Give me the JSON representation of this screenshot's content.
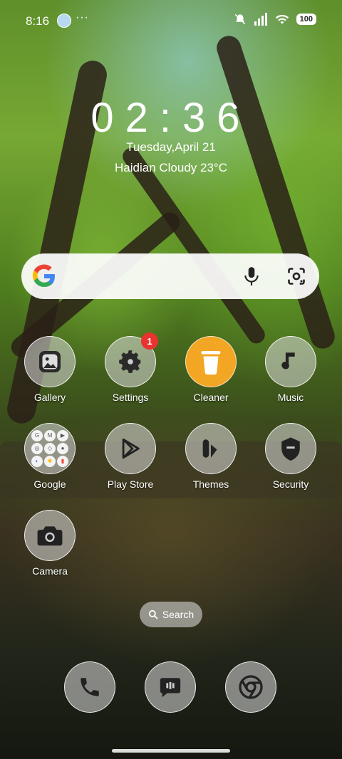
{
  "status_bar": {
    "time": "8:16",
    "dots": "···",
    "battery": "100",
    "icons": [
      "weather-icon",
      "mute-icon",
      "signal-icon",
      "wifi-icon",
      "battery-icon"
    ]
  },
  "lockclock": {
    "time": "02:36",
    "date": "Tuesday,April 21",
    "weather": "Haidian Cloudy 23°C"
  },
  "search_widget": {
    "icons": [
      "google-g-icon",
      "microphone-icon",
      "google-lens-icon"
    ]
  },
  "apps": [
    {
      "label": "Gallery",
      "icon": "gallery-icon"
    },
    {
      "label": "Settings",
      "icon": "gear-icon",
      "badge": "1"
    },
    {
      "label": "Cleaner",
      "icon": "trash-icon"
    },
    {
      "label": "Music",
      "icon": "music-note-icon"
    },
    {
      "label": "Google",
      "icon": "google-folder-icon",
      "folder_items": [
        "G",
        "M",
        "▶",
        "◎",
        "◇",
        "●",
        "◐",
        "✱",
        "▮"
      ]
    },
    {
      "label": "Play Store",
      "icon": "play-store-icon"
    },
    {
      "label": "Themes",
      "icon": "themes-icon"
    },
    {
      "label": "Security",
      "icon": "shield-icon"
    },
    {
      "label": "Camera",
      "icon": "camera-icon"
    }
  ],
  "search_pill": {
    "label": "Search"
  },
  "dock": [
    {
      "icon": "phone-icon"
    },
    {
      "icon": "messages-icon"
    },
    {
      "icon": "chrome-icon"
    }
  ],
  "colors": {
    "badge": "#e8332f",
    "cleaner": "#f2a624",
    "google_blue": "#4285F4",
    "google_red": "#EA4335",
    "google_yellow": "#FBBC05",
    "google_green": "#34A853"
  }
}
